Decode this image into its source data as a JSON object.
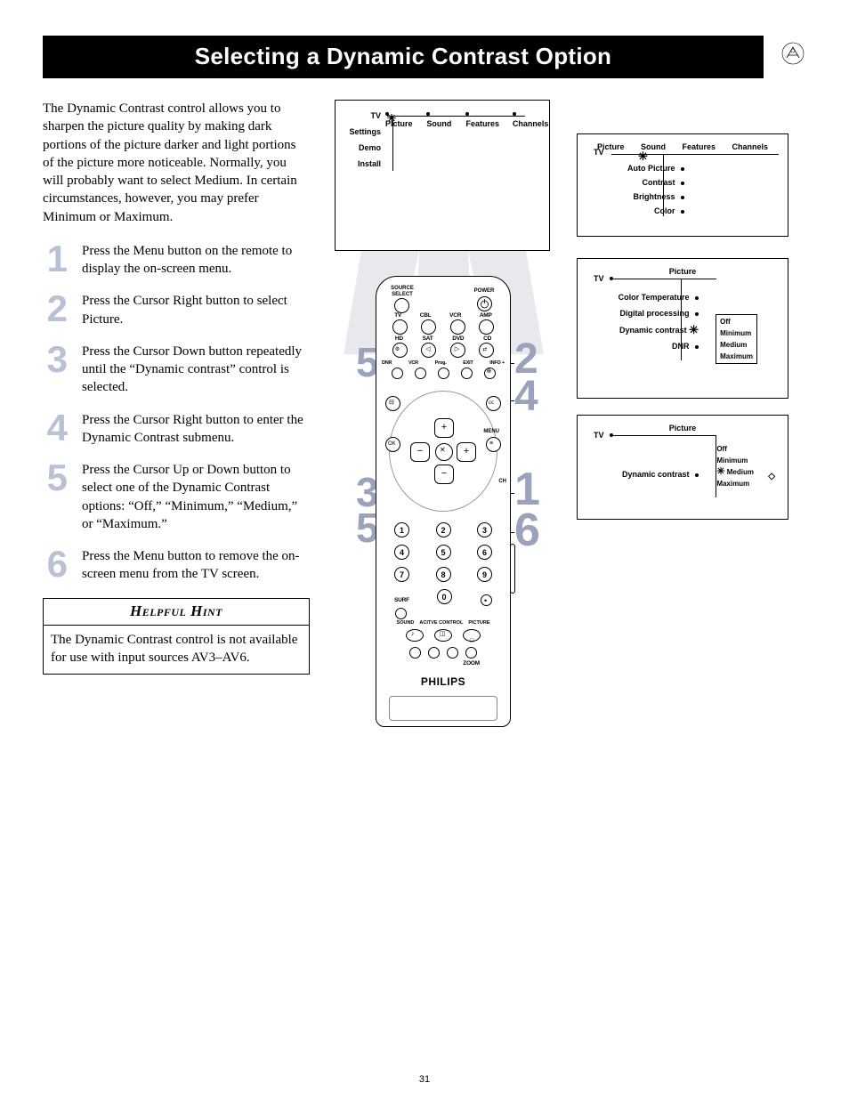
{
  "title": "Selecting a Dynamic Contrast Option",
  "intro": "The Dynamic Contrast control allows you to sharpen the picture quality by making dark portions of the picture darker and light portions of the picture more noticeable. Normally, you will probably want to select Medium. In certain circumstances, however, you may prefer Minimum or Maximum.",
  "steps": [
    {
      "n": "1",
      "t": "Press the Menu button on the remote to display the on-screen menu."
    },
    {
      "n": "2",
      "t": "Press the Cursor Right button to select Picture."
    },
    {
      "n": "3",
      "t": "Press the Cursor Down button repeatedly until the “Dynamic contrast” control is selected."
    },
    {
      "n": "4",
      "t": "Press the Cursor Right button to enter the Dynamic Contrast submenu."
    },
    {
      "n": "5",
      "t": "Press the Cursor Up or Down button to select one of the Dynamic Contrast options: “Off,” “Minimum,” “Medium,” or “Maximum.”"
    },
    {
      "n": "6",
      "t": "Press the Menu button to remove the on-screen menu from the TV screen."
    }
  ],
  "hint": {
    "title": "Helpful Hint",
    "body": "The Dynamic Contrast control is not available for use with input sources AV3–AV6."
  },
  "menu1": {
    "tabs": [
      "Picture",
      "Sound",
      "Features",
      "Channels"
    ],
    "side": [
      "TV",
      "Settings",
      "Demo",
      "Install"
    ]
  },
  "menu2": {
    "title": "Picture",
    "tabs": [
      "Picture",
      "Sound",
      "Features",
      "Channels"
    ],
    "side": [
      "TV"
    ],
    "items": [
      "Auto Picture",
      "Contrast",
      "Brightness",
      "Color"
    ]
  },
  "menu3": {
    "title": "Picture",
    "side": [
      "TV"
    ],
    "items": [
      "Color Temperature",
      "Digital processing",
      "Dynamic contrast",
      "DNR"
    ],
    "opts": [
      "Off",
      "Minimum",
      "Medium",
      "Maximum"
    ],
    "selected": "Dynamic contrast"
  },
  "menu4": {
    "title": "Picture",
    "side": [
      "TV"
    ],
    "item": "Dynamic contrast",
    "opts": [
      "Off",
      "Minimum",
      "Medium",
      "Maximum"
    ],
    "selected": "Medium"
  },
  "remote": {
    "top": {
      "source": "SOURCE SELECT",
      "power": "POWER"
    },
    "row1": [
      "TV",
      "CBL",
      "VCR",
      "AMP"
    ],
    "row2": [
      "HD",
      "SAT",
      "DVD",
      "CD"
    ],
    "row3lbl": [
      "DNR",
      "VCR",
      "Prog.",
      "EXIT",
      "INFO +"
    ],
    "menu": "MENU",
    "ok": "OK",
    "ch": "CH",
    "nums": [
      "1",
      "2",
      "3",
      "4",
      "5",
      "6",
      "7",
      "8",
      "9",
      "0"
    ],
    "surf": "SURF",
    "bottom": [
      "SOUND",
      "ACITVE CONTROL",
      "PICTURE"
    ],
    "zoom": "ZOOM",
    "brand": "PHILIPS"
  },
  "callouts": {
    "c5a": "5",
    "c2": "2",
    "c4": "4",
    "c3": "3",
    "c5b": "5",
    "c1": "1",
    "c6": "6"
  },
  "pagenum": "31"
}
